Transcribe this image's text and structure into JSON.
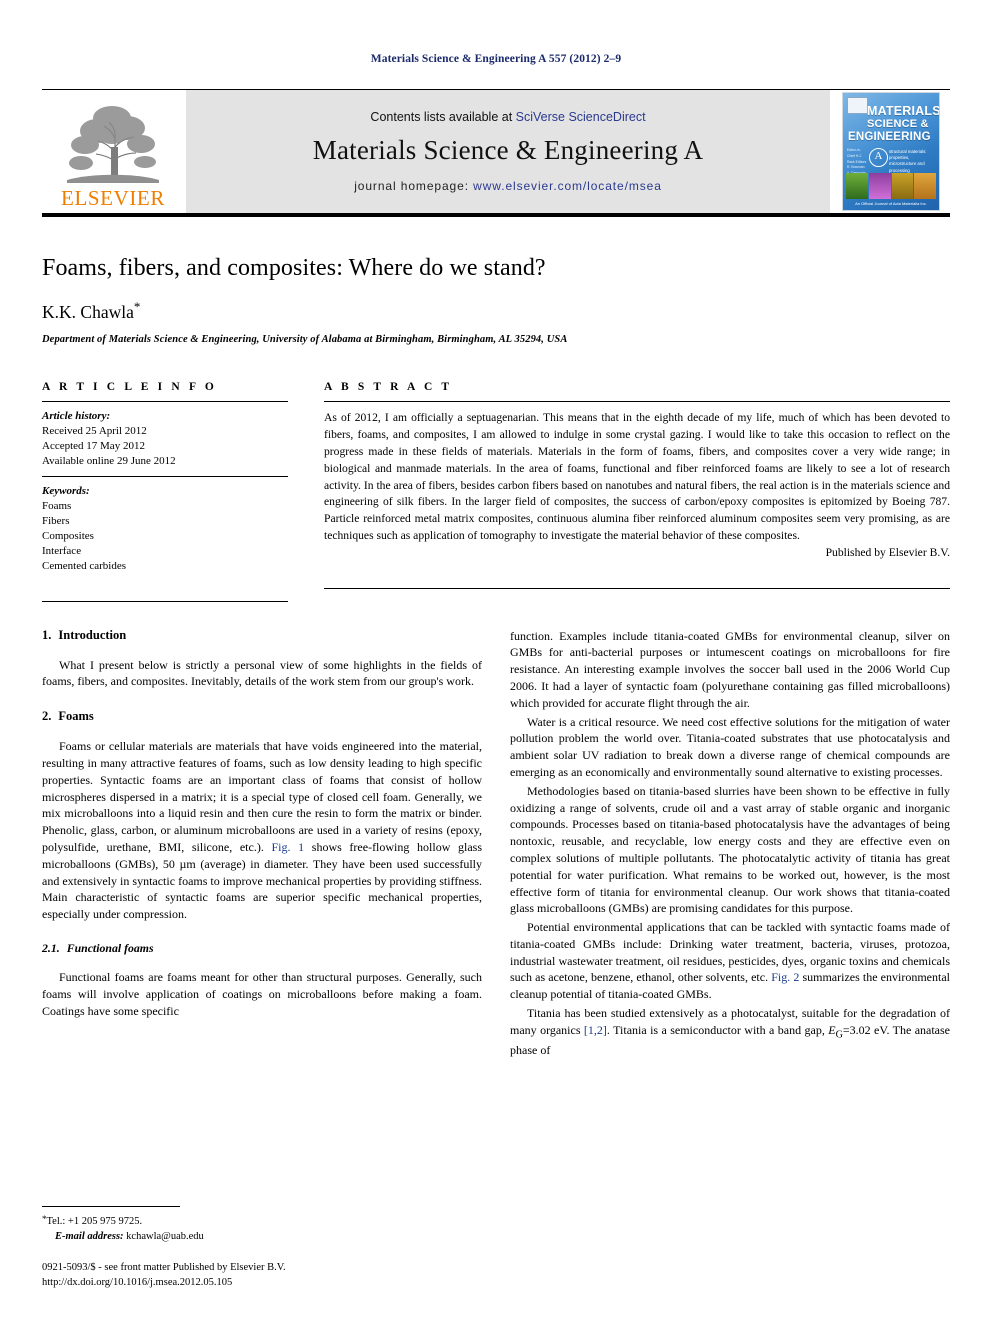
{
  "running_head": "Materials Science & Engineering A 557 (2012) 2–9",
  "masthead": {
    "publisher_name": "ELSEVIER",
    "contents_prefix": "Contents lists available at ",
    "contents_link": "SciVerse ScienceDirect",
    "journal_title": "Materials Science & Engineering A",
    "homepage_prefix": "journal homepage: ",
    "homepage_url": "www.elsevier.com/locate/msea",
    "cover": {
      "line1": "MATERIALS",
      "line2": "SCIENCE &",
      "line3": "ENGINEERING",
      "badge": "A",
      "subtitle": "structural materials: properties, microstructure and processing",
      "left_column": "Editor-in-Chief\nH.J. Rack\n\nEditors\nR. Bowman\nA. Dasgupta\nJ.J. Lewandowski\nV.K. Vasudevan",
      "caption": "An Official Journal of\nActa Materialia Inc."
    }
  },
  "article": {
    "title": "Foams, fibers, and composites: Where do we stand?",
    "author": "K.K. Chawla",
    "author_mark": "*",
    "affiliation": "Department of Materials Science & Engineering, University of Alabama at Birmingham, Birmingham, AL 35294, USA"
  },
  "article_info": {
    "heading": "A R T I C L E   I N F O",
    "history_label": "Article history:",
    "history": [
      "Received 25 April 2012",
      "Accepted 17 May 2012",
      "Available online 29 June 2012"
    ],
    "keywords_label": "Keywords:",
    "keywords": [
      "Foams",
      "Fibers",
      "Composites",
      "Interface",
      "Cemented carbides"
    ]
  },
  "abstract": {
    "heading": "A B S T R A C T",
    "text": "As of 2012, I am officially a septuagenarian. This means that in the eighth decade of my life, much of which has been devoted to fibers, foams, and composites, I am allowed to indulge in some crystal gazing. I would like to take this occasion to reflect on the progress made in these fields of materials. Materials in the form of foams, fibers, and composites cover a very wide range; in biological and manmade materials. In the area of foams, functional and fiber reinforced foams are likely to see a lot of research activity. In the area of fibers, besides carbon fibers based on nanotubes and natural fibers, the real action is in the materials science and engineering of silk fibers. In the larger field of composites, the success of carbon/epoxy composites is epitomized by Boeing 787. Particle reinforced metal matrix composites, continuous alumina fiber reinforced aluminum composites seem very promising, as are techniques such as application of tomography to investigate the material behavior of these composites.",
    "copyright": "Published by Elsevier B.V."
  },
  "sections": {
    "introduction": {
      "number": "1.",
      "title": "Introduction",
      "paragraph": "What I present below is strictly a personal view of some highlights in the fields of foams, fibers, and composites. Inevitably, details of the work stem from our group's work."
    },
    "foams": {
      "number": "2.",
      "title": "Foams",
      "paragraph_part1": "Foams or cellular materials are materials that have voids engineered into the material, resulting in many attractive features of foams, such as low density leading to high specific properties. Syntactic foams are an important class of foams that consist of hollow microspheres dispersed in a matrix; it is a special type of closed cell foam. Generally, we mix microballoons into a liquid resin and then cure the resin to form the matrix or binder. Phenolic, glass, carbon, or aluminum microballoons are used in a variety of resins (epoxy, polysulfide, urethane, BMI, silicone, etc.). ",
      "figure_link1": "Fig. 1",
      "paragraph_part2": " shows free-flowing hollow glass microballoons (GMBs), 50 µm (average) in diameter. They have been used successfully and extensively in syntactic foams to improve mechanical properties by providing stiffness. Main characteristic of syntactic foams are superior specific mechanical properties, especially under compression."
    },
    "functional_foams": {
      "number": "2.1.",
      "title": "Functional foams",
      "paragraph_left": "Functional foams are foams meant for other than structural purposes. Generally, such foams will involve application of coatings on microballoons before making a foam. Coatings have some specific",
      "paragraph_right_cont": "function. Examples include titania-coated GMBs for environmental cleanup, silver on GMBs for anti-bacterial purposes or intumescent coatings on microballoons for fire resistance. An interesting example involves the soccer ball used in the 2006 World Cup 2006. It had a layer of syntactic foam (polyurethane containing gas filled microballoons) which provided for accurate flight through the air."
    },
    "right_column": {
      "para_water": "Water is a critical resource. We need cost effective solutions for the mitigation of water pollution problem the world over. Titania-coated substrates that use photocatalysis and ambient solar UV radiation to break down a diverse range of chemical compounds are emerging as an economically and environmentally sound alternative to existing processes.",
      "para_methodologies": "Methodologies based on titania-based slurries have been shown to be effective in fully oxidizing a range of solvents, crude oil and a vast array of stable organic and inorganic compounds. Processes based on titania-based photocatalysis have the advantages of being nontoxic, reusable, and recyclable, low energy costs and they are effective even on complex solutions of multiple pollutants. The photocatalytic activity of titania has great potential for water purification. What remains to be worked out, however, is the most effective form of titania for environmental cleanup. Our work shows that titania-coated glass microballoons (GMBs) are promising candidates for this purpose.",
      "para_potential_part1": "Potential environmental applications that can be tackled with syntactic foams made of titania-coated GMBs include: Drinking water treatment, bacteria, viruses, protozoa, industrial wastewater treatment, oil residues, pesticides, dyes, organic toxins and chemicals such as acetone, benzene, ethanol, other solvents, etc. ",
      "figure_link2": "Fig. 2",
      "para_potential_part2": " summarizes the environmental cleanup potential of titania-coated GMBs.",
      "para_titania_part1": "Titania has been studied extensively as a photocatalyst, suitable for the degradation of many organics ",
      "citation": "[1,2]",
      "para_titania_part2": ". Titania is a semiconductor with a band gap, ",
      "bandgap_symbol": "E",
      "bandgap_subscript": "G",
      "bandgap_value": "=3.02 eV",
      "para_titania_part3": ". The anatase phase of"
    }
  },
  "footnotes": {
    "tel_mark": "*",
    "tel": "Tel.: +1 205 975 9725.",
    "email_label": "E-mail address:",
    "email": "kchawla@uab.edu",
    "issn_line": "0921-5093/$ - see front matter Published by Elsevier B.V.",
    "doi_line": "http://dx.doi.org/10.1016/j.msea.2012.05.105"
  },
  "colors": {
    "link": "#1a3a8f",
    "elsevier_orange": "#ef7d00",
    "running_head": "#1a2a6c",
    "band_gray": "#e3e3e3"
  }
}
